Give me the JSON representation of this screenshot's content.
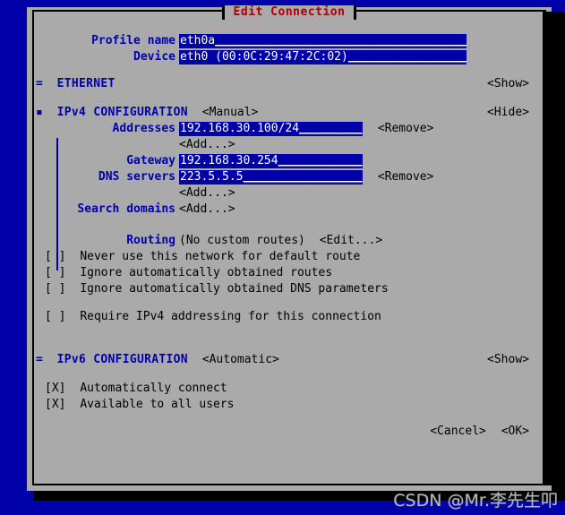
{
  "window": {
    "title": "Edit Connection",
    "title_color": "#aa0000",
    "background_color": "#0000aa",
    "panel_color": "#aaaaaa"
  },
  "form": {
    "profile_name": {
      "label": "Profile name",
      "value": "eth0a",
      "filler": "______________________________________"
    },
    "device": {
      "label": "Device",
      "value": "eth0 (00:0C:29:47:2C:02)",
      "filler": "___________________"
    }
  },
  "sections": {
    "ethernet": {
      "marker": "=",
      "label": "ETHERNET",
      "toggle_label": "<Show>"
    },
    "ipv4": {
      "marker": "▪",
      "label": "IPv4 CONFIGURATION",
      "mode": "<Manual>",
      "toggle_label": "<Hide>",
      "addresses": {
        "label": "Addresses",
        "value": "192.168.30.100/24",
        "filler": "_________",
        "remove_label": "<Remove>",
        "add_label": "<Add...>"
      },
      "gateway": {
        "label": "Gateway",
        "value": "192.168.30.254",
        "filler": "____________"
      },
      "dns": {
        "label": "DNS servers",
        "value": "223.5.5.5",
        "filler": "_________________",
        "remove_label": "<Remove>",
        "add_label": "<Add...>"
      },
      "search_domains": {
        "label": "Search domains",
        "add_label": "<Add...>"
      },
      "routing": {
        "label": "Routing",
        "status": "(No custom routes)",
        "edit_label": "<Edit...>"
      },
      "checkboxes": [
        {
          "box": "[ ]",
          "label": "Never use this network for default route",
          "checked": false
        },
        {
          "box": "[ ]",
          "label": "Ignore automatically obtained routes",
          "checked": false
        },
        {
          "box": "[ ]",
          "label": "Ignore automatically obtained DNS parameters",
          "checked": false
        },
        {
          "box": "[ ]",
          "label": "Require IPv4 addressing for this connection",
          "checked": false
        }
      ]
    },
    "ipv6": {
      "marker": "=",
      "label": "IPv6 CONFIGURATION",
      "mode": "<Automatic>",
      "toggle_label": "<Show>"
    }
  },
  "global_options": [
    {
      "box": "[X]",
      "label": "Automatically connect",
      "checked": true
    },
    {
      "box": "[X]",
      "label": "Available to all users",
      "checked": true
    }
  ],
  "actions": {
    "cancel_label": "<Cancel>",
    "ok_label": "<OK>"
  },
  "watermark": {
    "text": "CSDN @Mr.李先生叩"
  }
}
